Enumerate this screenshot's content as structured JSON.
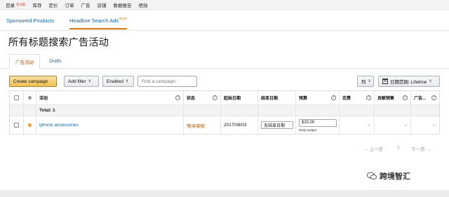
{
  "topnav": {
    "items": [
      {
        "label": "目录",
        "badge": "新功能"
      },
      {
        "label": "库存"
      },
      {
        "label": "定价"
      },
      {
        "label": "订单"
      },
      {
        "label": "广告"
      },
      {
        "label": "店铺"
      },
      {
        "label": "数据报告"
      },
      {
        "label": "绩效"
      }
    ]
  },
  "subnav": {
    "tabs": [
      {
        "label": "Sponsored Products"
      },
      {
        "label": "Headline Search Ads",
        "badge": "NEW"
      }
    ]
  },
  "page": {
    "title": "所有标题搜索广告活动"
  },
  "tabs": [
    {
      "label": "广告活动"
    },
    {
      "label": "Drafts"
    }
  ],
  "toolbar": {
    "create_label": "Create campaign",
    "add_filter_label": "Add filter",
    "enabled_label": "Enabled",
    "search_placeholder": "Find a campaign",
    "columns_label": "列",
    "date_range_label": "日期范围: Lifetime"
  },
  "table": {
    "headers": {
      "campaign": "活动",
      "status": "状态",
      "start_date": "起始日期",
      "end_date": "结束日期",
      "budget": "预算",
      "spend": "花费",
      "sales": "贡献销售",
      "acos": "广告..."
    },
    "help_glyph": "?",
    "total_label": "Total: 1",
    "rows": [
      {
        "campaign": "iphone accessories",
        "status": "等待审核",
        "start_date": "2017/08/03",
        "end_date": "无结束日期",
        "budget": "$20.00",
        "budget_type": "Daily budget",
        "spend": "-",
        "sales": "-",
        "acos": "-",
        "status_dot_color": "#f0a01e"
      }
    ]
  },
  "pagination": {
    "prev": "← 上一页",
    "page": "1",
    "next": "下一页 →"
  },
  "watermark": {
    "text": "跨境智汇",
    "icon": "wechat-icon"
  },
  "colors": {
    "accent": "#e77600",
    "link": "#0066c0",
    "primary_button": "#f0c14b"
  }
}
